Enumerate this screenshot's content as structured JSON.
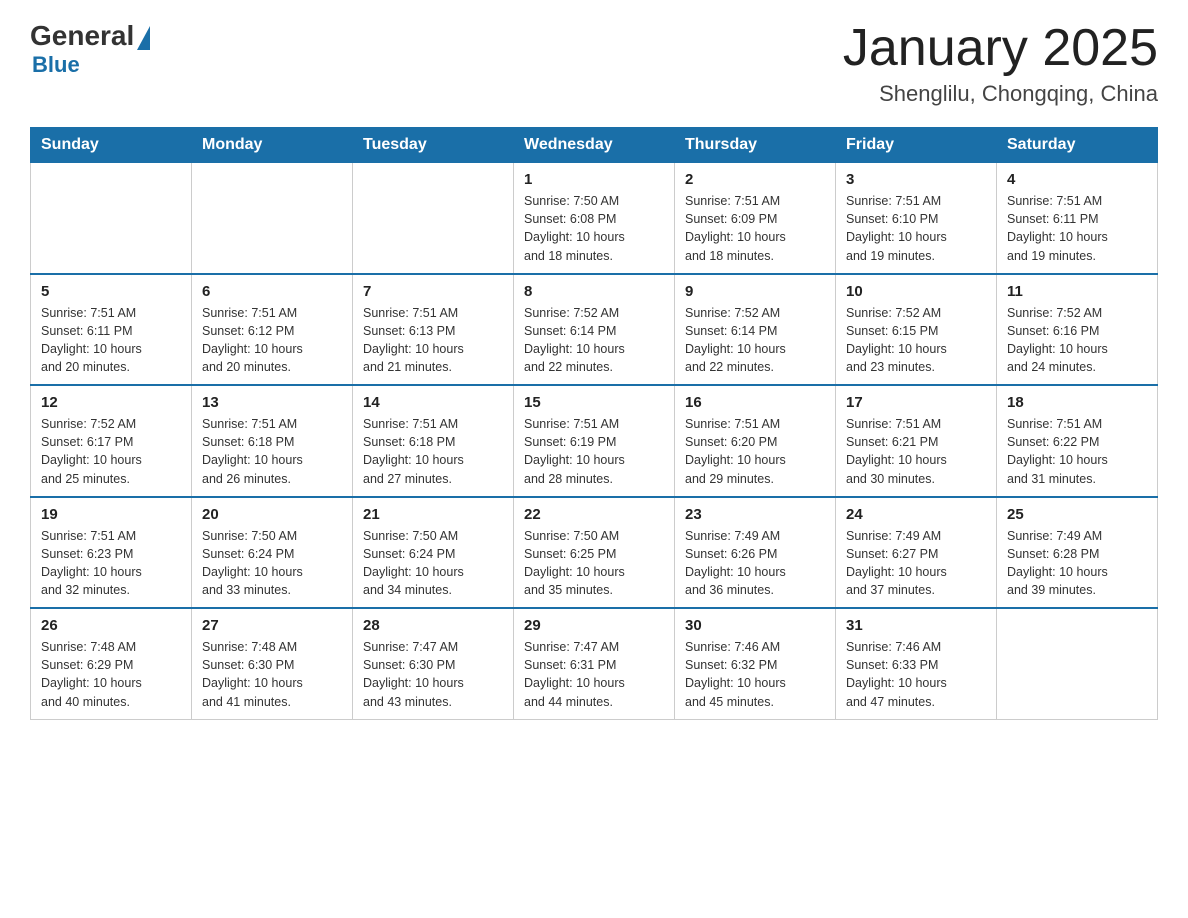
{
  "header": {
    "logo_general": "General",
    "logo_blue": "Blue",
    "month": "January 2025",
    "location": "Shenglilu, Chongqing, China"
  },
  "days_of_week": [
    "Sunday",
    "Monday",
    "Tuesday",
    "Wednesday",
    "Thursday",
    "Friday",
    "Saturday"
  ],
  "weeks": [
    [
      {
        "day": "",
        "info": ""
      },
      {
        "day": "",
        "info": ""
      },
      {
        "day": "",
        "info": ""
      },
      {
        "day": "1",
        "info": "Sunrise: 7:50 AM\nSunset: 6:08 PM\nDaylight: 10 hours\nand 18 minutes."
      },
      {
        "day": "2",
        "info": "Sunrise: 7:51 AM\nSunset: 6:09 PM\nDaylight: 10 hours\nand 18 minutes."
      },
      {
        "day": "3",
        "info": "Sunrise: 7:51 AM\nSunset: 6:10 PM\nDaylight: 10 hours\nand 19 minutes."
      },
      {
        "day": "4",
        "info": "Sunrise: 7:51 AM\nSunset: 6:11 PM\nDaylight: 10 hours\nand 19 minutes."
      }
    ],
    [
      {
        "day": "5",
        "info": "Sunrise: 7:51 AM\nSunset: 6:11 PM\nDaylight: 10 hours\nand 20 minutes."
      },
      {
        "day": "6",
        "info": "Sunrise: 7:51 AM\nSunset: 6:12 PM\nDaylight: 10 hours\nand 20 minutes."
      },
      {
        "day": "7",
        "info": "Sunrise: 7:51 AM\nSunset: 6:13 PM\nDaylight: 10 hours\nand 21 minutes."
      },
      {
        "day": "8",
        "info": "Sunrise: 7:52 AM\nSunset: 6:14 PM\nDaylight: 10 hours\nand 22 minutes."
      },
      {
        "day": "9",
        "info": "Sunrise: 7:52 AM\nSunset: 6:14 PM\nDaylight: 10 hours\nand 22 minutes."
      },
      {
        "day": "10",
        "info": "Sunrise: 7:52 AM\nSunset: 6:15 PM\nDaylight: 10 hours\nand 23 minutes."
      },
      {
        "day": "11",
        "info": "Sunrise: 7:52 AM\nSunset: 6:16 PM\nDaylight: 10 hours\nand 24 minutes."
      }
    ],
    [
      {
        "day": "12",
        "info": "Sunrise: 7:52 AM\nSunset: 6:17 PM\nDaylight: 10 hours\nand 25 minutes."
      },
      {
        "day": "13",
        "info": "Sunrise: 7:51 AM\nSunset: 6:18 PM\nDaylight: 10 hours\nand 26 minutes."
      },
      {
        "day": "14",
        "info": "Sunrise: 7:51 AM\nSunset: 6:18 PM\nDaylight: 10 hours\nand 27 minutes."
      },
      {
        "day": "15",
        "info": "Sunrise: 7:51 AM\nSunset: 6:19 PM\nDaylight: 10 hours\nand 28 minutes."
      },
      {
        "day": "16",
        "info": "Sunrise: 7:51 AM\nSunset: 6:20 PM\nDaylight: 10 hours\nand 29 minutes."
      },
      {
        "day": "17",
        "info": "Sunrise: 7:51 AM\nSunset: 6:21 PM\nDaylight: 10 hours\nand 30 minutes."
      },
      {
        "day": "18",
        "info": "Sunrise: 7:51 AM\nSunset: 6:22 PM\nDaylight: 10 hours\nand 31 minutes."
      }
    ],
    [
      {
        "day": "19",
        "info": "Sunrise: 7:51 AM\nSunset: 6:23 PM\nDaylight: 10 hours\nand 32 minutes."
      },
      {
        "day": "20",
        "info": "Sunrise: 7:50 AM\nSunset: 6:24 PM\nDaylight: 10 hours\nand 33 minutes."
      },
      {
        "day": "21",
        "info": "Sunrise: 7:50 AM\nSunset: 6:24 PM\nDaylight: 10 hours\nand 34 minutes."
      },
      {
        "day": "22",
        "info": "Sunrise: 7:50 AM\nSunset: 6:25 PM\nDaylight: 10 hours\nand 35 minutes."
      },
      {
        "day": "23",
        "info": "Sunrise: 7:49 AM\nSunset: 6:26 PM\nDaylight: 10 hours\nand 36 minutes."
      },
      {
        "day": "24",
        "info": "Sunrise: 7:49 AM\nSunset: 6:27 PM\nDaylight: 10 hours\nand 37 minutes."
      },
      {
        "day": "25",
        "info": "Sunrise: 7:49 AM\nSunset: 6:28 PM\nDaylight: 10 hours\nand 39 minutes."
      }
    ],
    [
      {
        "day": "26",
        "info": "Sunrise: 7:48 AM\nSunset: 6:29 PM\nDaylight: 10 hours\nand 40 minutes."
      },
      {
        "day": "27",
        "info": "Sunrise: 7:48 AM\nSunset: 6:30 PM\nDaylight: 10 hours\nand 41 minutes."
      },
      {
        "day": "28",
        "info": "Sunrise: 7:47 AM\nSunset: 6:30 PM\nDaylight: 10 hours\nand 43 minutes."
      },
      {
        "day": "29",
        "info": "Sunrise: 7:47 AM\nSunset: 6:31 PM\nDaylight: 10 hours\nand 44 minutes."
      },
      {
        "day": "30",
        "info": "Sunrise: 7:46 AM\nSunset: 6:32 PM\nDaylight: 10 hours\nand 45 minutes."
      },
      {
        "day": "31",
        "info": "Sunrise: 7:46 AM\nSunset: 6:33 PM\nDaylight: 10 hours\nand 47 minutes."
      },
      {
        "day": "",
        "info": ""
      }
    ]
  ]
}
